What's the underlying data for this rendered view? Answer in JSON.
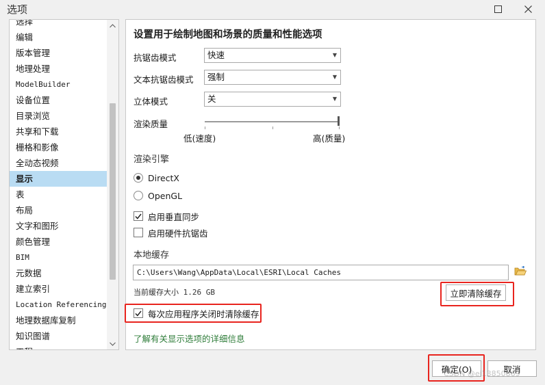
{
  "window": {
    "title": "选项"
  },
  "nav": {
    "items": [
      {
        "label": "选择"
      },
      {
        "label": "编辑"
      },
      {
        "label": "版本管理"
      },
      {
        "label": "地理处理"
      },
      {
        "label": "ModelBuilder"
      },
      {
        "label": "设备位置"
      },
      {
        "label": "目录浏览"
      },
      {
        "label": "共享和下载"
      },
      {
        "label": "栅格和影像"
      },
      {
        "label": "全动态视频"
      },
      {
        "label": "显示"
      },
      {
        "label": "表"
      },
      {
        "label": "布局"
      },
      {
        "label": "文字和图形"
      },
      {
        "label": "颜色管理"
      },
      {
        "label": "BIM"
      },
      {
        "label": "元数据"
      },
      {
        "label": "建立索引"
      },
      {
        "label": "Location Referencing"
      },
      {
        "label": "地理数据库复制"
      },
      {
        "label": "知识图谱"
      },
      {
        "label": "工程"
      }
    ],
    "selected": "显示"
  },
  "panel": {
    "heading": "设置用于绘制地图和场景的质量和性能选项",
    "antialias": {
      "label": "抗锯齿模式",
      "value": "快速"
    },
    "text_antialias": {
      "label": "文本抗锯齿模式",
      "value": "强制"
    },
    "stereo": {
      "label": "立体模式",
      "value": "关"
    },
    "render_quality": {
      "label": "渲染质量",
      "low": "低(速度)",
      "high": "高(质量)",
      "level": 1.0
    },
    "engine": {
      "title": "渲染引擎",
      "options": [
        "DirectX",
        "OpenGL"
      ],
      "selected": "DirectX"
    },
    "vsync": {
      "label": "启用垂直同步",
      "checked": true
    },
    "hw_antialias": {
      "label": "启用硬件抗锯齿",
      "checked": false
    },
    "cache": {
      "title": "本地缓存",
      "path": "C:\\Users\\Wang\\AppData\\Local\\ESRI\\Local Caches",
      "size_text": "当前缓存大小 1.26 GB",
      "clear_button": "立即清除缓存",
      "clear_on_exit": {
        "label": "每次应用程序关闭时清除缓存",
        "checked": true
      }
    },
    "link": "了解有关显示选项的详细信息"
  },
  "footer": {
    "ok": "确定(O)",
    "cancel": "取消"
  },
  "watermark": "CSDN @ei13850869",
  "colors": {
    "selected_bg": "#b9dcf3",
    "highlight_box": "#e8231d",
    "link": "#2f7d3a"
  }
}
